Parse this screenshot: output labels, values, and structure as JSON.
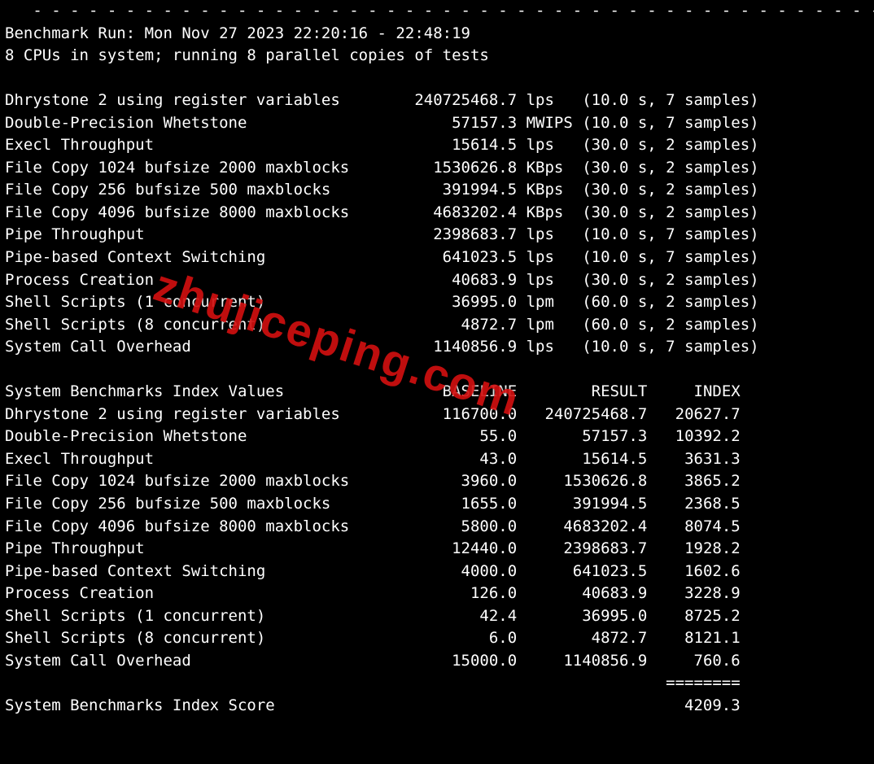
{
  "divider_top": "   - - - - - - - - - - - - - - - - - - - - - - - - - - - - - - - - - - - - - - - - - - - - - -",
  "header": {
    "run_line": "Benchmark Run: Mon Nov 27 2023 22:20:16 - 22:48:19",
    "cpu_line": "8 CPUs in system; running 8 parallel copies of tests"
  },
  "results": [
    {
      "name": "Dhrystone 2 using register variables",
      "value": "240725468.7",
      "unit": "lps",
      "info": "(10.0 s, 7 samples)"
    },
    {
      "name": "Double-Precision Whetstone",
      "value": "57157.3",
      "unit": "MWIPS",
      "info": "(10.0 s, 7 samples)"
    },
    {
      "name": "Execl Throughput",
      "value": "15614.5",
      "unit": "lps",
      "info": "(30.0 s, 2 samples)"
    },
    {
      "name": "File Copy 1024 bufsize 2000 maxblocks",
      "value": "1530626.8",
      "unit": "KBps",
      "info": "(30.0 s, 2 samples)"
    },
    {
      "name": "File Copy 256 bufsize 500 maxblocks",
      "value": "391994.5",
      "unit": "KBps",
      "info": "(30.0 s, 2 samples)"
    },
    {
      "name": "File Copy 4096 bufsize 8000 maxblocks",
      "value": "4683202.4",
      "unit": "KBps",
      "info": "(30.0 s, 2 samples)"
    },
    {
      "name": "Pipe Throughput",
      "value": "2398683.7",
      "unit": "lps",
      "info": "(10.0 s, 7 samples)"
    },
    {
      "name": "Pipe-based Context Switching",
      "value": "641023.5",
      "unit": "lps",
      "info": "(10.0 s, 7 samples)"
    },
    {
      "name": "Process Creation",
      "value": "40683.9",
      "unit": "lps",
      "info": "(30.0 s, 2 samples)"
    },
    {
      "name": "Shell Scripts (1 concurrent)",
      "value": "36995.0",
      "unit": "lpm",
      "info": "(60.0 s, 2 samples)"
    },
    {
      "name": "Shell Scripts (8 concurrent)",
      "value": "4872.7",
      "unit": "lpm",
      "info": "(60.0 s, 2 samples)"
    },
    {
      "name": "System Call Overhead",
      "value": "1140856.9",
      "unit": "lps",
      "info": "(10.0 s, 7 samples)"
    }
  ],
  "index_header": {
    "title": "System Benchmarks Index Values",
    "c1": "BASELINE",
    "c2": "RESULT",
    "c3": "INDEX"
  },
  "index_rows": [
    {
      "name": "Dhrystone 2 using register variables",
      "baseline": "116700.0",
      "result": "240725468.7",
      "index": "20627.7"
    },
    {
      "name": "Double-Precision Whetstone",
      "baseline": "55.0",
      "result": "57157.3",
      "index": "10392.2"
    },
    {
      "name": "Execl Throughput",
      "baseline": "43.0",
      "result": "15614.5",
      "index": "3631.3"
    },
    {
      "name": "File Copy 1024 bufsize 2000 maxblocks",
      "baseline": "3960.0",
      "result": "1530626.8",
      "index": "3865.2"
    },
    {
      "name": "File Copy 256 bufsize 500 maxblocks",
      "baseline": "1655.0",
      "result": "391994.5",
      "index": "2368.5"
    },
    {
      "name": "File Copy 4096 bufsize 8000 maxblocks",
      "baseline": "5800.0",
      "result": "4683202.4",
      "index": "8074.5"
    },
    {
      "name": "Pipe Throughput",
      "baseline": "12440.0",
      "result": "2398683.7",
      "index": "1928.2"
    },
    {
      "name": "Pipe-based Context Switching",
      "baseline": "4000.0",
      "result": "641023.5",
      "index": "1602.6"
    },
    {
      "name": "Process Creation",
      "baseline": "126.0",
      "result": "40683.9",
      "index": "3228.9"
    },
    {
      "name": "Shell Scripts (1 concurrent)",
      "baseline": "42.4",
      "result": "36995.0",
      "index": "8725.2"
    },
    {
      "name": "Shell Scripts (8 concurrent)",
      "baseline": "6.0",
      "result": "4872.7",
      "index": "8121.1"
    },
    {
      "name": "System Call Overhead",
      "baseline": "15000.0",
      "result": "1140856.9",
      "index": "760.6"
    }
  ],
  "index_divider": "========",
  "score": {
    "label": "System Benchmarks Index Score",
    "value": "4209.3"
  },
  "watermark": "zhujiceping.com"
}
